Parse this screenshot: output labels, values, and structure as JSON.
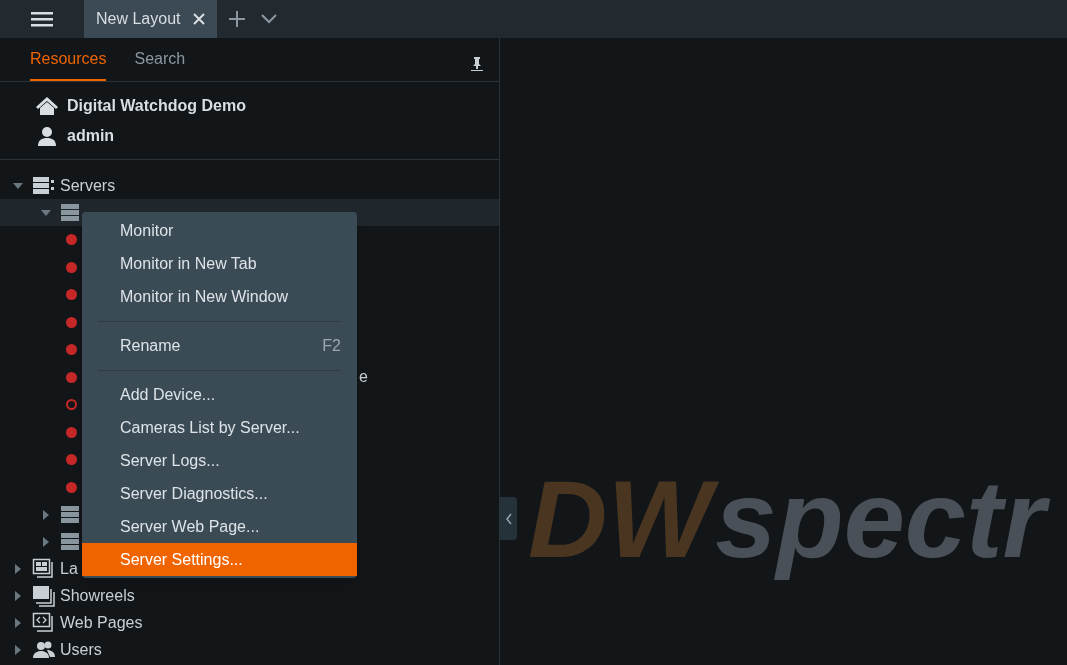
{
  "top_bar": {
    "tabs": [
      {
        "label": "New Layout",
        "selected": true
      }
    ]
  },
  "panel_tabs": [
    {
      "label": "Resources",
      "selected": true
    },
    {
      "label": "Search",
      "selected": false
    }
  ],
  "system": {
    "name": "Digital Watchdog Demo",
    "user": "admin"
  },
  "tree": [
    {
      "label": "Servers",
      "kind": "servers",
      "expanded": true,
      "children": [
        {
          "kind": "server",
          "expanded": true,
          "selected": true,
          "children": [
            {
              "kind": "camera",
              "online": true
            },
            {
              "kind": "camera",
              "online": true
            },
            {
              "kind": "camera",
              "online": true
            },
            {
              "kind": "camera",
              "online": true
            },
            {
              "kind": "camera",
              "online": true
            },
            {
              "kind": "camera",
              "online": true,
              "label": "e"
            },
            {
              "kind": "camera",
              "online": false
            },
            {
              "kind": "camera",
              "online": true
            },
            {
              "kind": "camera",
              "online": true
            },
            {
              "kind": "camera",
              "online": true
            }
          ]
        },
        {
          "kind": "server",
          "expanded": false,
          "selected": false
        },
        {
          "kind": "server",
          "expanded": false,
          "selected": false
        }
      ]
    },
    {
      "label": "La",
      "kind": "layouts",
      "expanded": false
    },
    {
      "label": "Showreels",
      "kind": "showreels",
      "expanded": false
    },
    {
      "label": "Web Pages",
      "kind": "webpages",
      "expanded": false
    },
    {
      "label": "Users",
      "kind": "users",
      "expanded": false
    }
  ],
  "context_menu": [
    {
      "label": "Monitor",
      "selected": false
    },
    {
      "label": "Monitor in New Tab",
      "selected": false
    },
    {
      "label": "Monitor in New Window",
      "selected": false
    },
    {
      "kind": "separator"
    },
    {
      "label": "Rename",
      "shortcut": "F2",
      "selected": false
    },
    {
      "kind": "separator"
    },
    {
      "label": "Add Device...",
      "selected": false
    },
    {
      "label": "Cameras List by Server...",
      "selected": false
    },
    {
      "label": "Server Logs...",
      "selected": false
    },
    {
      "label": "Server Diagnostics...",
      "selected": false
    },
    {
      "label": "Server Web Page...",
      "selected": false
    },
    {
      "label": "Server Settings...",
      "selected": true
    }
  ],
  "background_logo": {
    "brand": "DW",
    "product": "spectr"
  }
}
